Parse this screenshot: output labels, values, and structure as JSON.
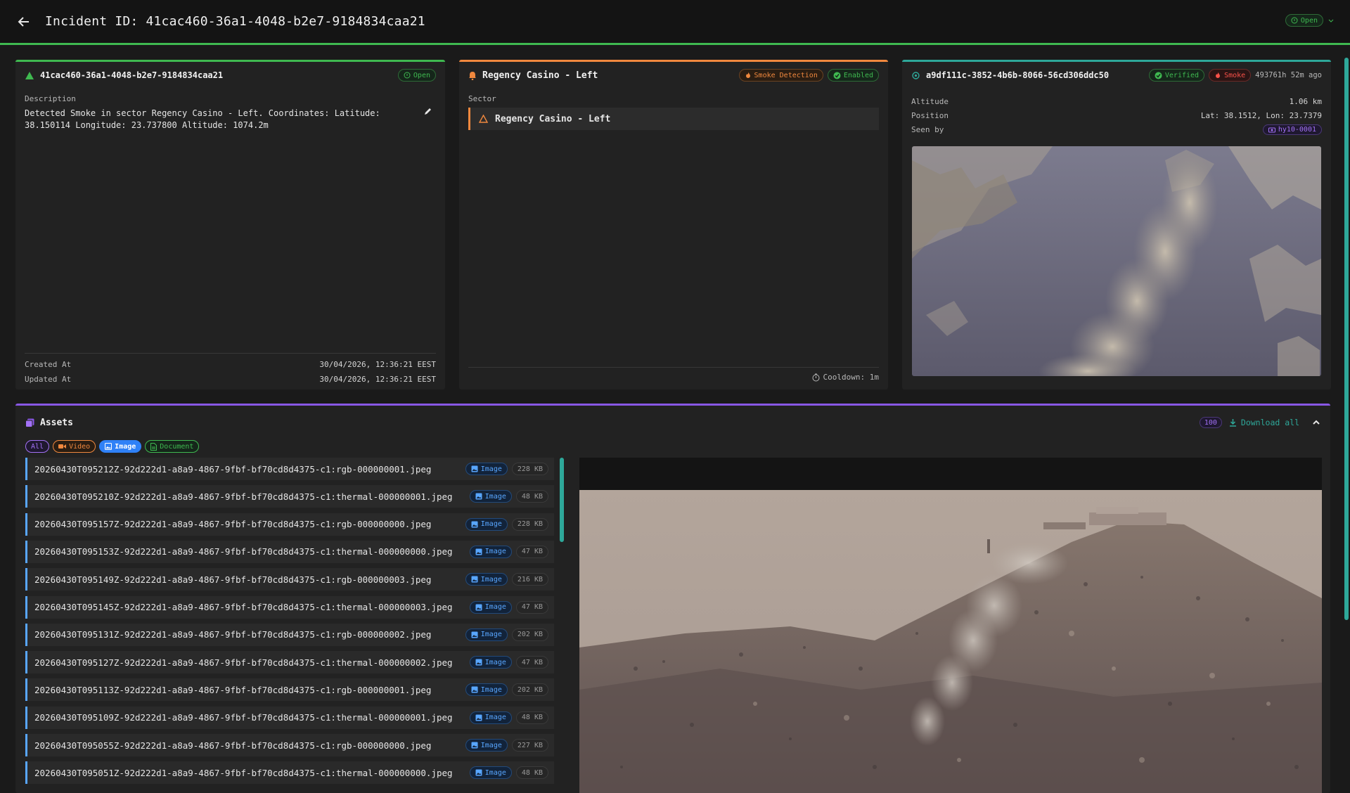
{
  "header": {
    "title": "Incident ID: 41cac460-36a1-4048-b2e7-9184834caa21",
    "status": "Open"
  },
  "incident_card": {
    "id": "41cac460-36a1-4048-b2e7-9184834caa21",
    "status": "Open",
    "description_label": "Description",
    "description": "Detected Smoke in sector Regency Casino - Left. Coordinates: Latitude: 38.150114 Longitude: 23.737800 Altitude: 1074.2m",
    "created_label": "Created At",
    "created_value": "30/04/2026, 12:36:21 EEST",
    "updated_label": "Updated At",
    "updated_value": "30/04/2026, 12:36:21 EEST"
  },
  "sector_card": {
    "title": "Regency Casino - Left",
    "badge_type": "Smoke Detection",
    "badge_state": "Enabled",
    "sector_label": "Sector",
    "sector_item": "Regency Casino - Left",
    "cooldown": "Cooldown: 1m"
  },
  "detection_card": {
    "id": "a9df111c-3852-4b6b-8066-56cd306ddc50",
    "badge_verified": "Verified",
    "badge_smoke": "Smoke",
    "time_ago": "493761h 52m ago",
    "altitude_label": "Altitude",
    "altitude_value": "1.06 km",
    "position_label": "Position",
    "position_value": "Lat: 38.1512, Lon: 23.7379",
    "seen_by_label": "Seen by",
    "seen_by_value": "hy10-0001"
  },
  "assets": {
    "title": "Assets",
    "count": "100",
    "download_label": "Download all",
    "filters": [
      "All",
      "Video",
      "Image",
      "Document"
    ],
    "active_filter": "Image",
    "files": [
      {
        "name": "20260430T095212Z-92d222d1-a8a9-4867-9fbf-bf70cd8d4375-c1:rgb-000000001.jpeg",
        "type": "Image",
        "size": "228 KB"
      },
      {
        "name": "20260430T095210Z-92d222d1-a8a9-4867-9fbf-bf70cd8d4375-c1:thermal-000000001.jpeg",
        "type": "Image",
        "size": "48 KB"
      },
      {
        "name": "20260430T095157Z-92d222d1-a8a9-4867-9fbf-bf70cd8d4375-c1:rgb-000000000.jpeg",
        "type": "Image",
        "size": "228 KB"
      },
      {
        "name": "20260430T095153Z-92d222d1-a8a9-4867-9fbf-bf70cd8d4375-c1:thermal-000000000.jpeg",
        "type": "Image",
        "size": "47 KB"
      },
      {
        "name": "20260430T095149Z-92d222d1-a8a9-4867-9fbf-bf70cd8d4375-c1:rgb-000000003.jpeg",
        "type": "Image",
        "size": "216 KB"
      },
      {
        "name": "20260430T095145Z-92d222d1-a8a9-4867-9fbf-bf70cd8d4375-c1:thermal-000000003.jpeg",
        "type": "Image",
        "size": "47 KB"
      },
      {
        "name": "20260430T095131Z-92d222d1-a8a9-4867-9fbf-bf70cd8d4375-c1:rgb-000000002.jpeg",
        "type": "Image",
        "size": "202 KB"
      },
      {
        "name": "20260430T095127Z-92d222d1-a8a9-4867-9fbf-bf70cd8d4375-c1:thermal-000000002.jpeg",
        "type": "Image",
        "size": "47 KB"
      },
      {
        "name": "20260430T095113Z-92d222d1-a8a9-4867-9fbf-bf70cd8d4375-c1:rgb-000000001.jpeg",
        "type": "Image",
        "size": "202 KB"
      },
      {
        "name": "20260430T095109Z-92d222d1-a8a9-4867-9fbf-bf70cd8d4375-c1:thermal-000000001.jpeg",
        "type": "Image",
        "size": "48 KB"
      },
      {
        "name": "20260430T095055Z-92d222d1-a8a9-4867-9fbf-bf70cd8d4375-c1:rgb-000000000.jpeg",
        "type": "Image",
        "size": "227 KB"
      },
      {
        "name": "20260430T095051Z-92d222d1-a8a9-4867-9fbf-bf70cd8d4375-c1:thermal-000000000.jpeg",
        "type": "Image",
        "size": "48 KB"
      }
    ]
  },
  "colors": {
    "accent_green": "#3fb950",
    "accent_orange": "#f0883e",
    "accent_teal": "#2ea89a",
    "accent_purple": "#8957e5",
    "accent_blue": "#58a6ff"
  }
}
